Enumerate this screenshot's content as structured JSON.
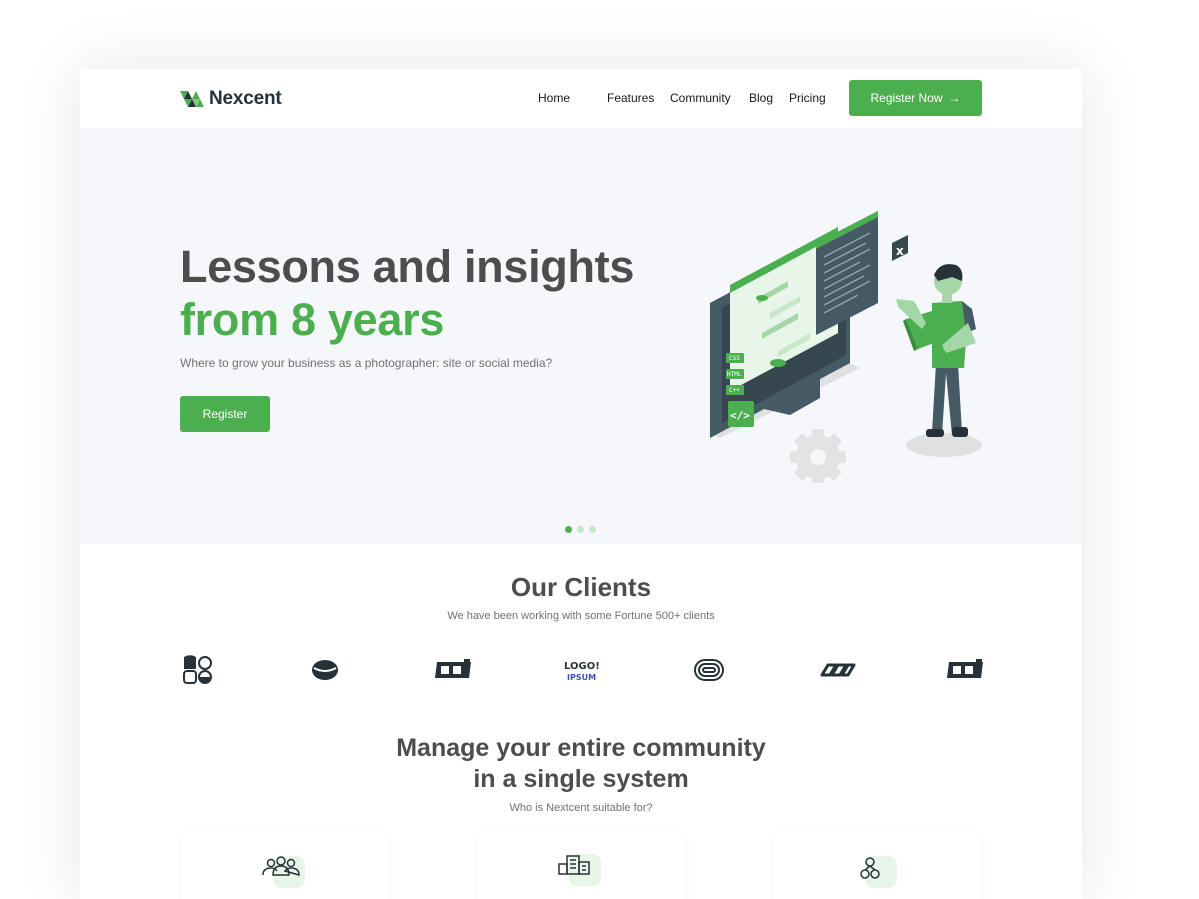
{
  "nav": {
    "brand": "Nexcent",
    "links": [
      "Home",
      "Features",
      "Community",
      "Blog",
      "Pricing"
    ],
    "cta_label": "Register Now",
    "cta_arrow": "→"
  },
  "hero": {
    "title_line1": "Lessons and insights",
    "title_line2": "from 8 years",
    "subtitle": "Where to grow your business as a photographer: site or social media?",
    "button_label": "Register",
    "slides": 3,
    "active_slide": 1,
    "illustration_labels": [
      "CSS",
      "HTML",
      "C++"
    ]
  },
  "clients": {
    "title": "Our Clients",
    "subtitle": "We have been working with some Fortune 500+ clients",
    "logos": [
      "client-logo-1",
      "client-logo-2",
      "client-logo-3",
      "client-logo-4",
      "client-logo-5",
      "client-logo-6",
      "client-logo-7"
    ],
    "logo_text": "LOGO IPSUM"
  },
  "community": {
    "title_line1": "Manage your entire community",
    "title_line2": "in a single system",
    "subtitle": "Who is Nextcent suitable for?",
    "cards": [
      {
        "icon": "members-icon"
      },
      {
        "icon": "building-icon"
      },
      {
        "icon": "hand-heart-icon"
      }
    ]
  },
  "colors": {
    "accent": "#4CAF4F",
    "text": "#4D4D4D",
    "hero_bg": "#F5F7FA"
  }
}
